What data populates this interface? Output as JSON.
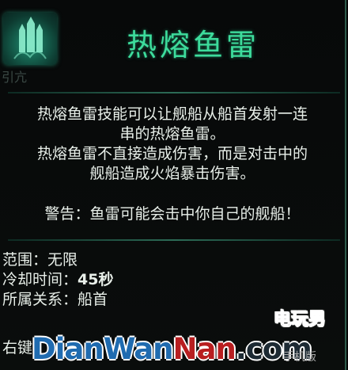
{
  "skill": {
    "icon": "torpedo-icon",
    "title": "热熔鱼雷",
    "under_icon_text": "引亢"
  },
  "description": {
    "lines": [
      "热熔鱼雷技能可以让舰船从船首发射一连",
      "串的热熔鱼雷。",
      "热熔鱼雷不直接造成伤害，而是对击中的",
      "舰船造成火焰暴击伤害。"
    ],
    "warning": "警告：鱼雷可能会击中你自己的舰船！"
  },
  "stats": [
    {
      "label": "范围",
      "value": "无限"
    },
    {
      "label": "冷却时间",
      "value": "45秒"
    },
    {
      "label": "所属关系",
      "value": "船首"
    }
  ],
  "stat_sep": "：",
  "hint": "右键",
  "watermark": {
    "brand": "电玩男",
    "part1": "DianWan",
    "part2": "Nan",
    "part3": ".com",
    "mobile": "手机版"
  },
  "colors": {
    "title": "#3ddc9c",
    "text": "#e8efe9"
  }
}
